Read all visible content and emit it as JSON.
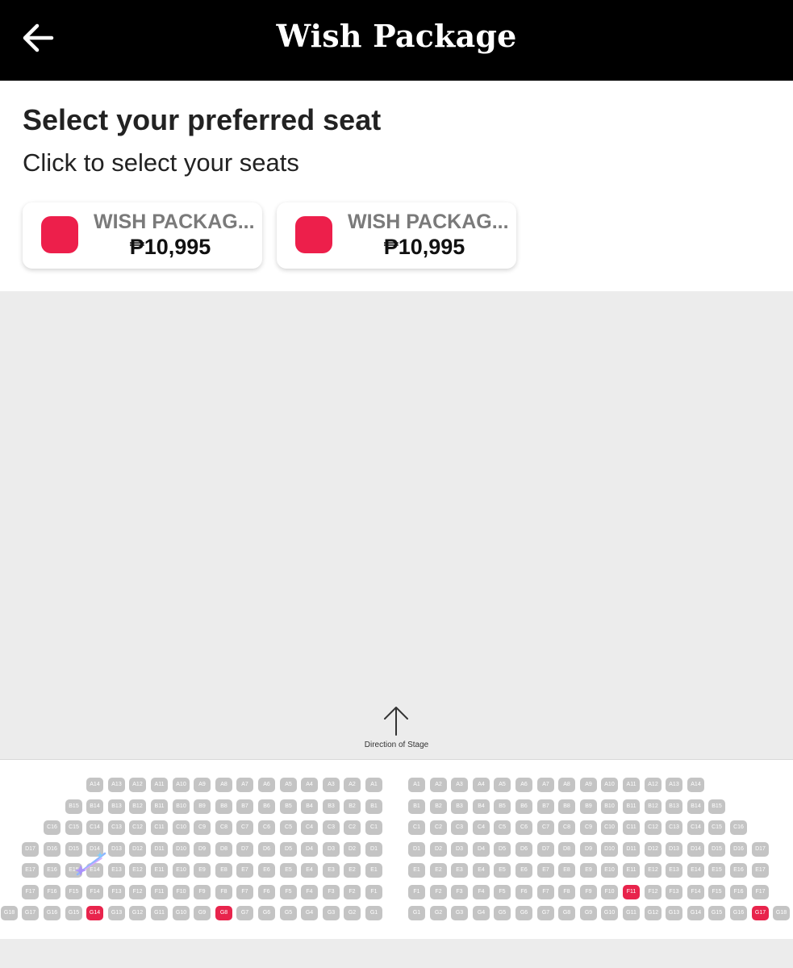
{
  "app_bar": {
    "title": "Wish Package",
    "back_icon": "arrow-left-icon"
  },
  "header": {
    "title": "Select your preferred seat",
    "subtitle": "Click to select your seats"
  },
  "legend": [
    {
      "name": "WISH PACKAG...",
      "price": "₱10,995",
      "color": "#ED1F4B"
    },
    {
      "name": "WISH PACKAG...",
      "price": "₱10,995",
      "color": "#ED1F4B"
    }
  ],
  "stage": {
    "label": "Direction of Stage",
    "icon": "arrow-up-icon"
  },
  "colors": {
    "available": "#C4C4C4",
    "selected": "#E8244C",
    "app_bar": "#000000"
  },
  "seat_map": {
    "left_block": [
      {
        "row": "A",
        "seats": [
          "A14",
          "A13",
          "A12",
          "A11",
          "A10",
          "A9",
          "A8",
          "A7",
          "A6",
          "A5",
          "A4",
          "A3",
          "A2",
          "A1"
        ]
      },
      {
        "row": "B",
        "seats": [
          "B15",
          "B14",
          "B13",
          "B12",
          "B11",
          "B10",
          "B9",
          "B8",
          "B7",
          "B6",
          "B5",
          "B4",
          "B3",
          "B2",
          "B1"
        ]
      },
      {
        "row": "C",
        "seats": [
          "C16",
          "C15",
          "C14",
          "C13",
          "C12",
          "C11",
          "C10",
          "C9",
          "C8",
          "C7",
          "C6",
          "C5",
          "C4",
          "C3",
          "C2",
          "C1"
        ]
      },
      {
        "row": "D",
        "seats": [
          "D17",
          "D16",
          "D15",
          "D14",
          "D13",
          "D12",
          "D11",
          "D10",
          "D9",
          "D8",
          "D7",
          "D6",
          "D5",
          "D4",
          "D3",
          "D2",
          "D1"
        ]
      },
      {
        "row": "E",
        "seats": [
          "E17",
          "E16",
          "E15",
          "E14",
          "E13",
          "E12",
          "E11",
          "E10",
          "E9",
          "E8",
          "E7",
          "E6",
          "E5",
          "E4",
          "E3",
          "E2",
          "E1"
        ]
      },
      {
        "row": "F",
        "seats": [
          "F17",
          "F16",
          "F15",
          "F14",
          "F13",
          "F12",
          "F11",
          "F10",
          "F9",
          "F8",
          "F7",
          "F6",
          "F5",
          "F4",
          "F3",
          "F2",
          "F1"
        ]
      },
      {
        "row": "G",
        "seats": [
          "G18",
          "G17",
          "G16",
          "G15",
          "G14",
          "G13",
          "G12",
          "G11",
          "G10",
          "G9",
          "G8",
          "G7",
          "G6",
          "G5",
          "G4",
          "G3",
          "G2",
          "G1"
        ]
      }
    ],
    "right_block": [
      {
        "row": "A",
        "seats": [
          "A1",
          "A2",
          "A3",
          "A4",
          "A5",
          "A6",
          "A7",
          "A8",
          "A9",
          "A10",
          "A11",
          "A12",
          "A13",
          "A14"
        ]
      },
      {
        "row": "B",
        "seats": [
          "B1",
          "B2",
          "B3",
          "B4",
          "B5",
          "B6",
          "B7",
          "B8",
          "B9",
          "B10",
          "B11",
          "B12",
          "B13",
          "B14",
          "B15"
        ]
      },
      {
        "row": "C",
        "seats": [
          "C1",
          "C2",
          "C3",
          "C4",
          "C5",
          "C6",
          "C7",
          "C8",
          "C9",
          "C10",
          "C11",
          "C12",
          "C13",
          "C14",
          "C15",
          "C16"
        ]
      },
      {
        "row": "D",
        "seats": [
          "D1",
          "D2",
          "D3",
          "D4",
          "D5",
          "D6",
          "D7",
          "D8",
          "D9",
          "D10",
          "D11",
          "D12",
          "D13",
          "D14",
          "D15",
          "D16",
          "D17"
        ]
      },
      {
        "row": "E",
        "seats": [
          "E1",
          "E2",
          "E3",
          "E4",
          "E5",
          "E6",
          "E7",
          "E8",
          "E9",
          "E10",
          "E11",
          "E12",
          "E13",
          "E14",
          "E15",
          "E16",
          "E17"
        ]
      },
      {
        "row": "F",
        "seats": [
          "F1",
          "F2",
          "F3",
          "F4",
          "F5",
          "F6",
          "F7",
          "F8",
          "F9",
          "F10",
          "F11",
          "F12",
          "F13",
          "F14",
          "F15",
          "F16",
          "F17"
        ]
      },
      {
        "row": "G",
        "seats": [
          "G1",
          "G2",
          "G3",
          "G4",
          "G5",
          "G6",
          "G7",
          "G8",
          "G9",
          "G10",
          "G11",
          "G12",
          "G13",
          "G14",
          "G15",
          "G16",
          "G17",
          "G18"
        ]
      }
    ],
    "selected": {
      "left": [
        "G14",
        "G8"
      ],
      "right": [
        "F11",
        "G17"
      ]
    }
  }
}
